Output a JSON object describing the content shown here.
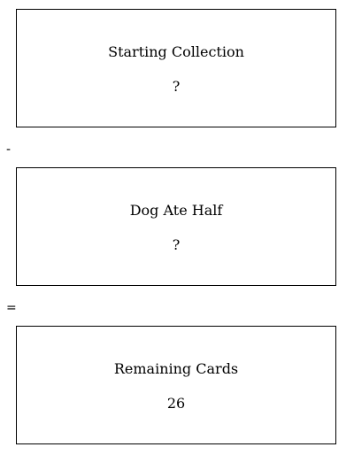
{
  "boxes": [
    {
      "label": "Starting Collection",
      "value": "?"
    },
    {
      "label": "Dog Ate Half",
      "value": "?"
    },
    {
      "label": "Remaining Cards",
      "value": "26"
    }
  ],
  "operators": [
    "-",
    "="
  ]
}
